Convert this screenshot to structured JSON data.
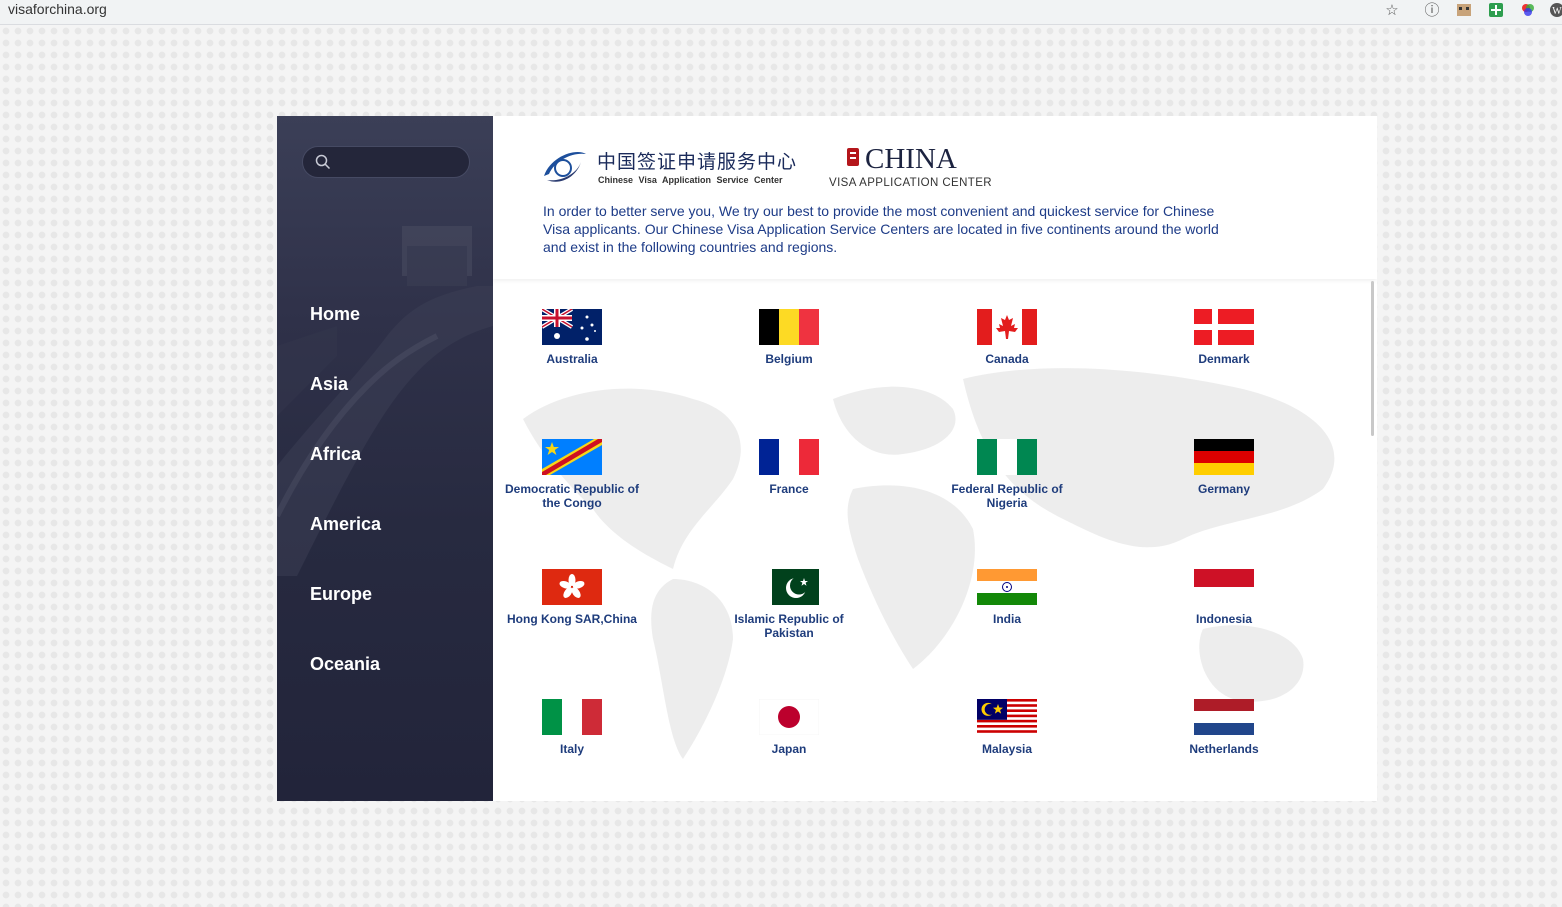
{
  "browser": {
    "url": "visaforchina.org"
  },
  "search": {
    "placeholder": ""
  },
  "nav": {
    "items": [
      {
        "label": "Home"
      },
      {
        "label": "Asia"
      },
      {
        "label": "Africa"
      },
      {
        "label": "America"
      },
      {
        "label": "Europe"
      },
      {
        "label": "Oceania"
      }
    ]
  },
  "header": {
    "logo_cn": "中国签证申请服务中心",
    "logo_en": "Chinese Visa Application Service Center",
    "logo2_big": "CHINA",
    "logo2_small": "VISA APPLICATION CENTER",
    "intro": "In order to better serve you, We try our best to provide the most convenient and quickest service for Chinese Visa applicants. Our Chinese Visa Application Service Centers are located in five continents around the world and exist in the following countries and regions."
  },
  "countries": [
    {
      "name": "Australia",
      "flag": "australia-flag-icon"
    },
    {
      "name": "Belgium",
      "flag": "belgium-flag-icon"
    },
    {
      "name": "Canada",
      "flag": "canada-flag-icon"
    },
    {
      "name": "Denmark",
      "flag": "denmark-flag-icon"
    },
    {
      "name": "Democratic Republic of the Congo",
      "flag": "dr-congo-flag-icon"
    },
    {
      "name": "France",
      "flag": "france-flag-icon"
    },
    {
      "name": "Federal Republic of Nigeria",
      "flag": "nigeria-flag-icon"
    },
    {
      "name": "Germany",
      "flag": "germany-flag-icon"
    },
    {
      "name": "Hong Kong SAR,China",
      "flag": "hong-kong-flag-icon"
    },
    {
      "name": "Islamic Republic of Pakistan",
      "flag": "pakistan-flag-icon"
    },
    {
      "name": "India",
      "flag": "india-flag-icon"
    },
    {
      "name": "Indonesia",
      "flag": "indonesia-flag-icon"
    },
    {
      "name": "Italy",
      "flag": "italy-flag-icon"
    },
    {
      "name": "Japan",
      "flag": "japan-flag-icon"
    },
    {
      "name": "Malaysia",
      "flag": "malaysia-flag-icon"
    },
    {
      "name": "Netherlands",
      "flag": "netherlands-flag-icon"
    }
  ],
  "colors": {
    "sidebar": "#2f3149",
    "link": "#1e3c7c"
  }
}
